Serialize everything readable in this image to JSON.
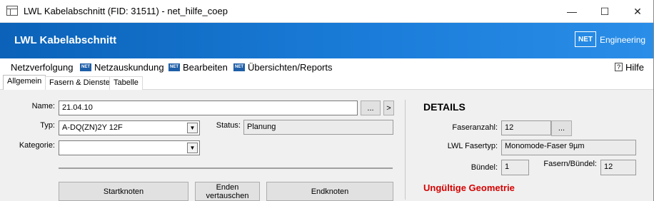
{
  "window": {
    "title": "LWL Kabelabschnitt (FID: 31511) - net_hilfe_coep",
    "minimize": "—",
    "maximize": "☐",
    "close": "✕"
  },
  "banner": {
    "title": "LWL Kabelabschnitt",
    "logo": "NET",
    "brand": "Engineering",
    "color": "#1a73cf"
  },
  "menu": {
    "items": [
      {
        "label": "Netzverfolgung",
        "icon": ""
      },
      {
        "label": "Netzauskundung",
        "icon": "NET"
      },
      {
        "label": "Bearbeiten",
        "icon": "NET"
      },
      {
        "label": "Übersichten/Reports",
        "icon": "NET"
      }
    ],
    "help": {
      "label": "Hilfe",
      "icon": "?"
    }
  },
  "tabs": [
    {
      "label": "Allgemein",
      "active": true
    },
    {
      "label": "Fasern & Dienste",
      "active": false
    },
    {
      "label": "Tabelle",
      "active": false
    }
  ],
  "form": {
    "name": {
      "label": "Name:",
      "value": "21.04.10",
      "browse": "...",
      "next": ">"
    },
    "typ": {
      "label": "Typ:",
      "value": "A-DQ(ZN)2Y 12F"
    },
    "status": {
      "label": "Status:",
      "value": "Planung"
    },
    "kategorie": {
      "label": "Kategorie:",
      "value": ""
    },
    "dropdown_arrow": "▼",
    "buttons": {
      "start": "Startknoten",
      "swap": "Enden vertauschen",
      "end": "Endknoten"
    }
  },
  "details": {
    "heading": "DETAILS",
    "faseranzahl": {
      "label": "Faseranzahl:",
      "value": "12",
      "browse": "..."
    },
    "fasertyp": {
      "label": "LWL Fasertyp:",
      "value": "Monomode-Faser 9µm"
    },
    "buendel": {
      "label": "Bündel:",
      "value": "1"
    },
    "fasern_buendel": {
      "label": "Fasern/Bündel:",
      "value": "12"
    },
    "warning": "Ungültige Geometrie",
    "warning_color": "#d40000"
  }
}
